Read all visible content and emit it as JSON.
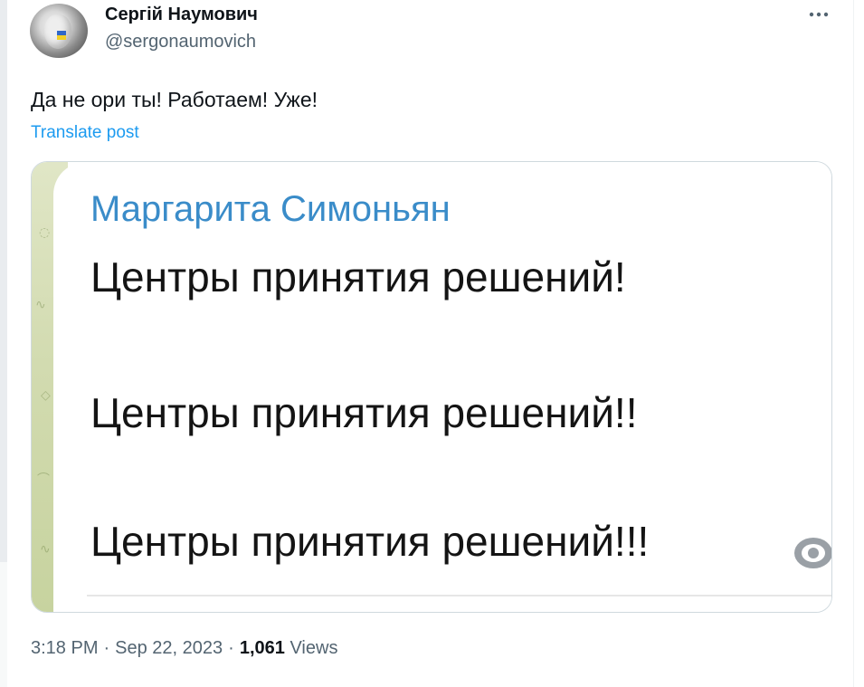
{
  "author": {
    "display_name": "Сергій Наумович",
    "handle": "@sergonaumovich"
  },
  "more_icon": "more-horizontal-icon",
  "post": {
    "text": "Да не ори ты! Работаем! Уже!",
    "translate_label": "Translate post"
  },
  "media": {
    "sender_name": "Маргарита Симоньян",
    "lines": [
      "Центры принятия решений!",
      "Центры принятия решений!!",
      "Центры принятия решений!!!"
    ],
    "view_icon": "eye-icon"
  },
  "meta": {
    "time": "3:18 PM",
    "separator": "·",
    "date": "Sep 22, 2023",
    "views_count": "1,061",
    "views_label": "Views"
  },
  "colors": {
    "link": "#1d9bf0",
    "text_primary": "#0f1419",
    "text_secondary": "#536471",
    "telegram_sender": "#3a8cc9"
  }
}
